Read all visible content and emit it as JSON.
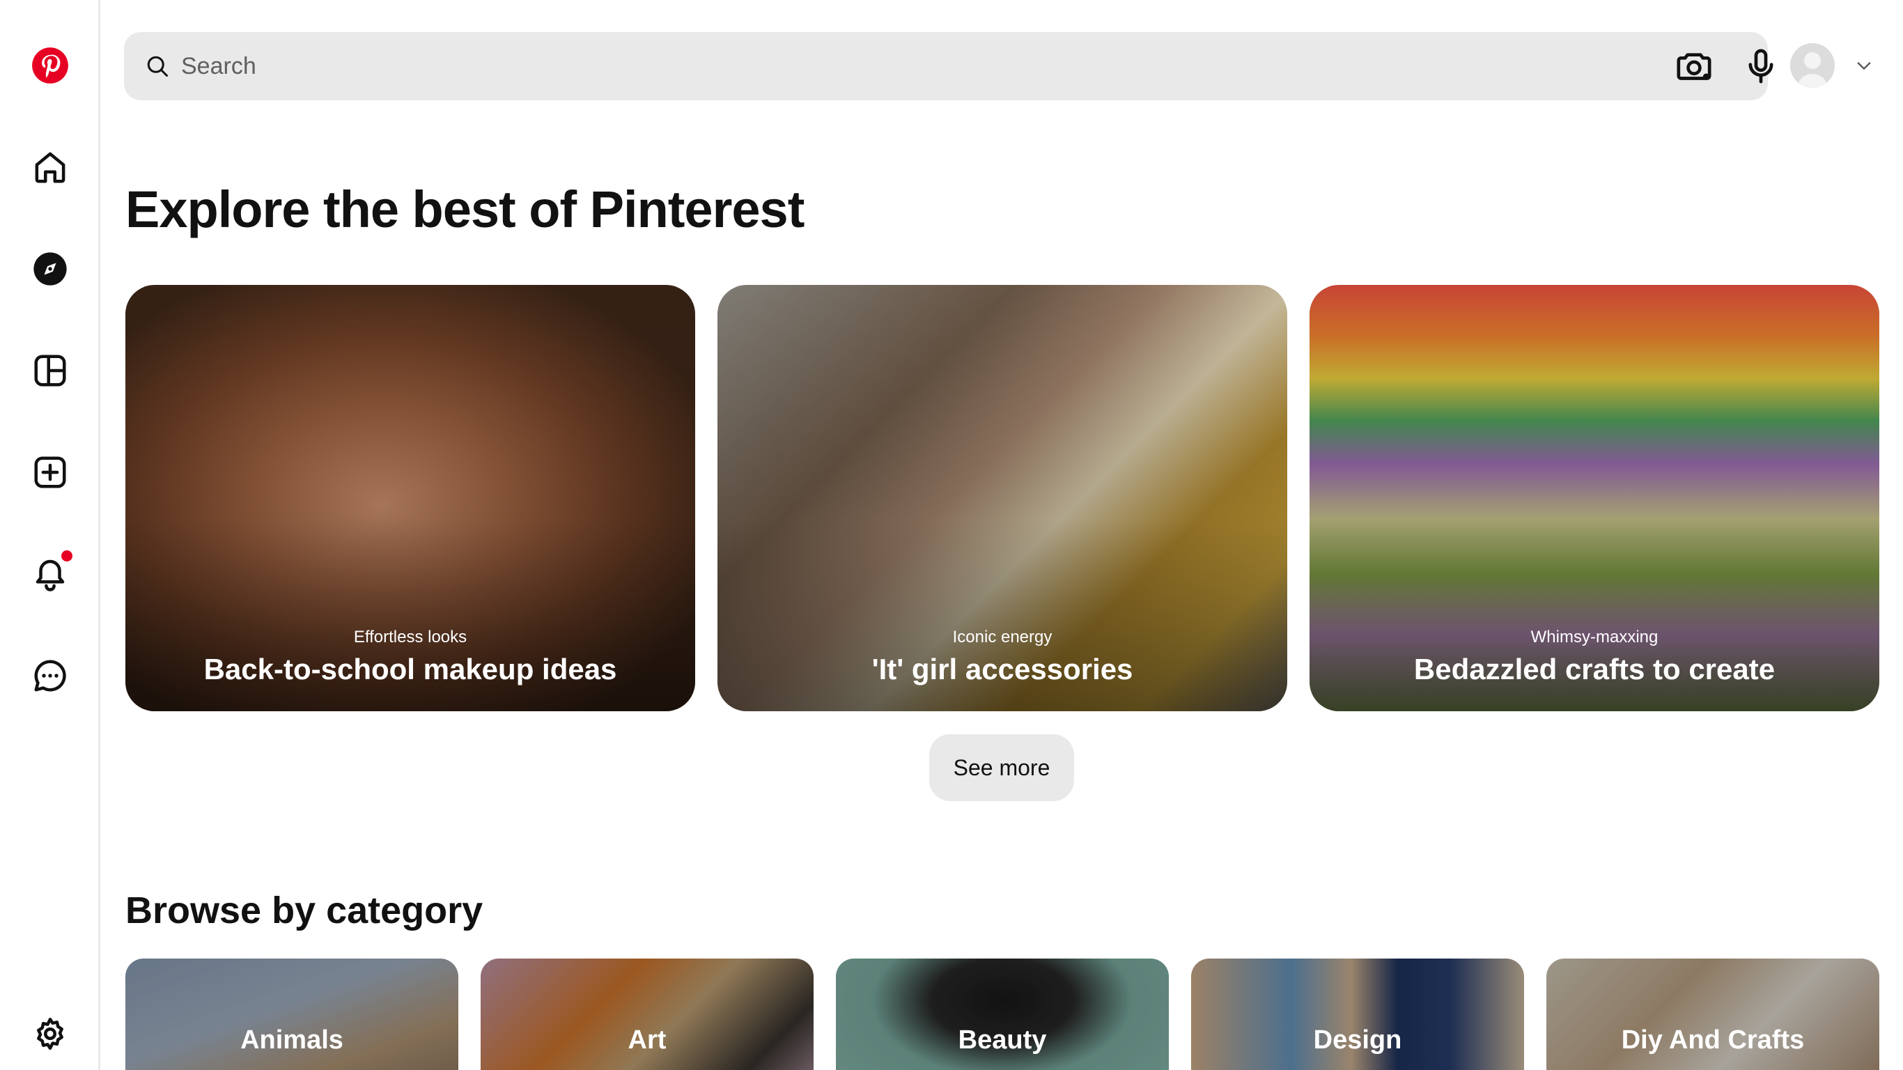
{
  "search": {
    "placeholder": "Search"
  },
  "sections": {
    "explore_title": "Explore the best of Pinterest",
    "browse_title": "Browse by category"
  },
  "explore_cards": [
    {
      "subtitle": "Effortless looks",
      "title": "Back-to-school makeup ideas"
    },
    {
      "subtitle": "Iconic energy",
      "title": "'It' girl accessories"
    },
    {
      "subtitle": "Whimsy-maxxing",
      "title": "Bedazzled crafts to create"
    }
  ],
  "see_more_label": "See more",
  "categories": [
    {
      "label": "Animals"
    },
    {
      "label": "Art"
    },
    {
      "label": "Beauty"
    },
    {
      "label": "Design"
    },
    {
      "label": "Diy And Crafts"
    }
  ],
  "sidebar": {
    "items": [
      "pinterest-logo-icon",
      "home-icon",
      "explore-icon",
      "boards-icon",
      "create-icon",
      "notifications-icon",
      "messages-icon",
      "settings-icon"
    ]
  },
  "colors": {
    "brand": "#e60023",
    "search_bg": "#e9e9e9"
  }
}
